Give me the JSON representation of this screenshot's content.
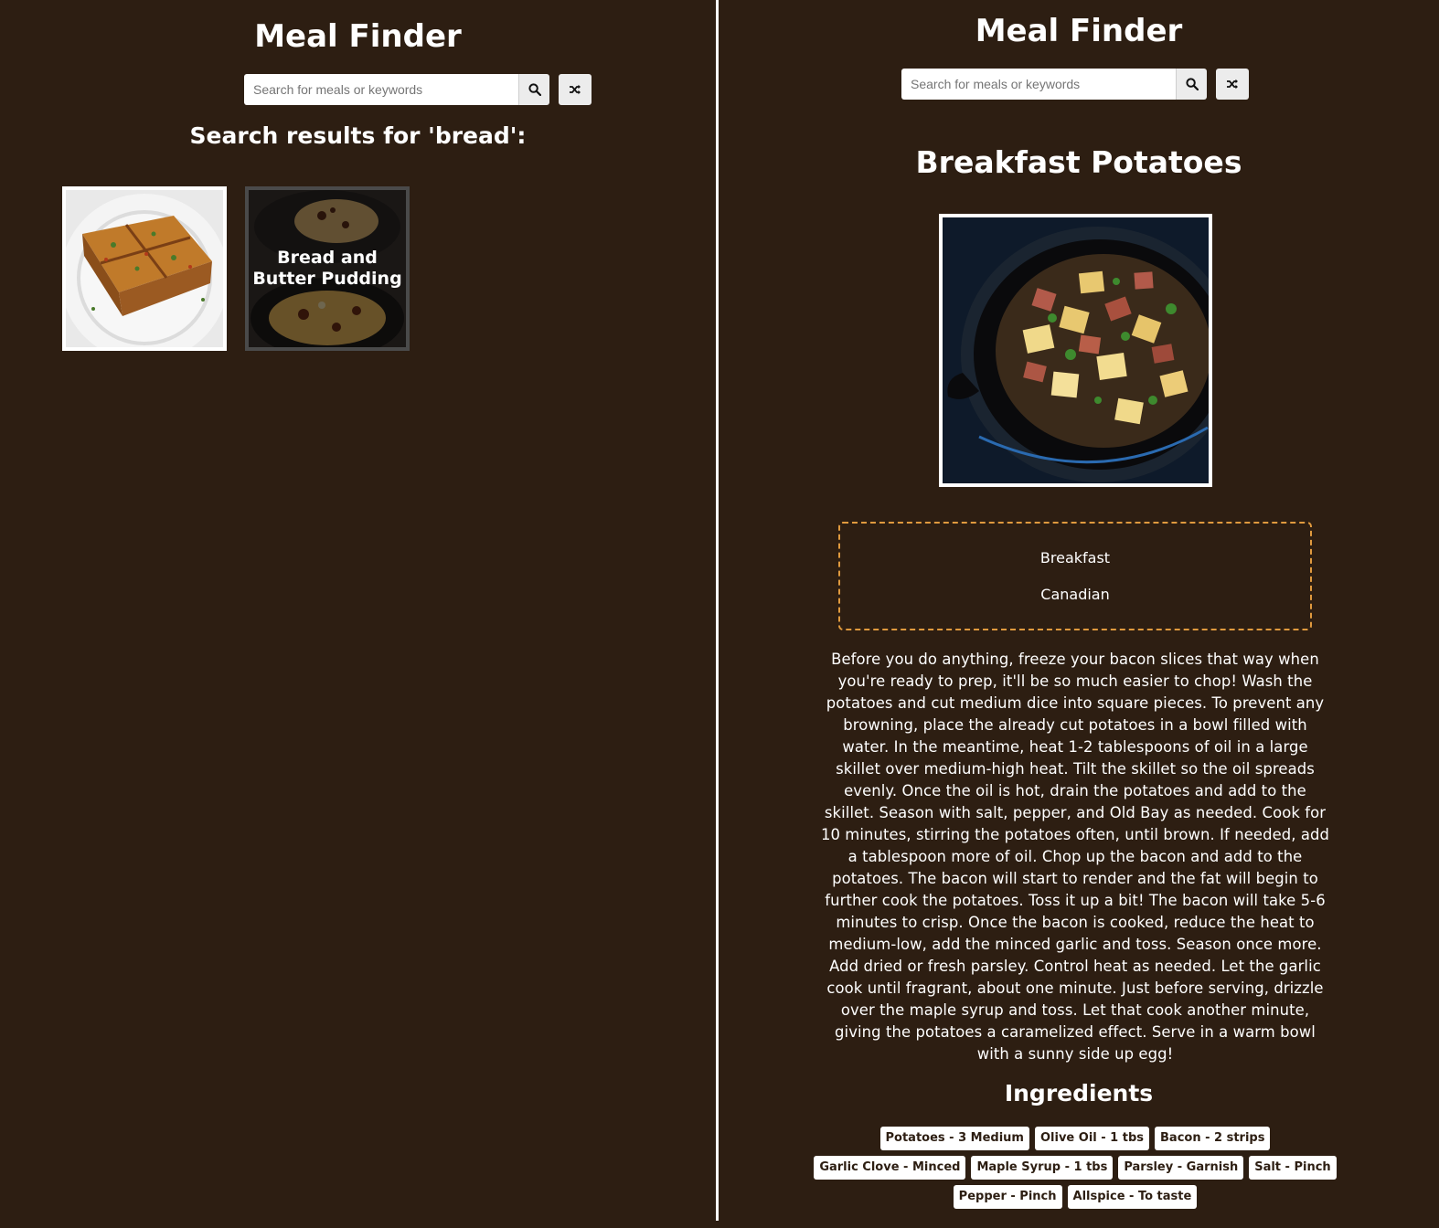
{
  "left_pane": {
    "app_title": "Meal Finder",
    "search": {
      "placeholder": "Search for meals or keywords",
      "value": "",
      "search_icon": "search-icon",
      "random_icon": "shuffle-icon"
    },
    "results_heading": "Search results for 'bread':",
    "meals": [
      {
        "title": "",
        "image": "baked-dish-square"
      },
      {
        "title": "Bread and Butter Pudding",
        "image": "bread-butter-pudding"
      }
    ]
  },
  "right_pane": {
    "app_title": "Meal Finder",
    "search": {
      "placeholder": "Search for meals or keywords",
      "value": "",
      "search_icon": "search-icon",
      "random_icon": "shuffle-icon"
    },
    "meal": {
      "title": "Breakfast Potatoes",
      "category": "Breakfast",
      "area": "Canadian",
      "instructions": "Before you do anything, freeze your bacon slices that way when you're ready to prep, it'll be so much easier to chop! Wash the potatoes and cut medium dice into square pieces. To prevent any browning, place the already cut potatoes in a bowl filled with water. In the meantime, heat 1-2 tablespoons of oil in a large skillet over medium-high heat. Tilt the skillet so the oil spreads evenly. Once the oil is hot, drain the potatoes and add to the skillet. Season with salt, pepper, and Old Bay as needed. Cook for 10 minutes, stirring the potatoes often, until brown. If needed, add a tablespoon more of oil. Chop up the bacon and add to the potatoes. The bacon will start to render and the fat will begin to further cook the potatoes. Toss it up a bit! The bacon will take 5-6 minutes to crisp. Once the bacon is cooked, reduce the heat to medium-low, add the minced garlic and toss. Season once more. Add dried or fresh parsley. Control heat as needed. Let the garlic cook until fragrant, about one minute. Just before serving, drizzle over the maple syrup and toss. Let that cook another minute, giving the potatoes a caramelized effect. Serve in a warm bowl with a sunny side up egg!",
      "ingredients_heading": "Ingredients",
      "ingredients": [
        "Potatoes - 3 Medium",
        "Olive Oil - 1 tbs",
        "Bacon - 2 strips",
        "Garlic Clove - Minced",
        "Maple Syrup - 1 tbs",
        "Parsley - Garnish",
        "Salt - Pinch",
        "Pepper - Pinch",
        "Allspice - To taste"
      ]
    }
  },
  "colors": {
    "background": "#2d1e12",
    "accent_border": "#e09a3e",
    "text": "#ffffff"
  }
}
